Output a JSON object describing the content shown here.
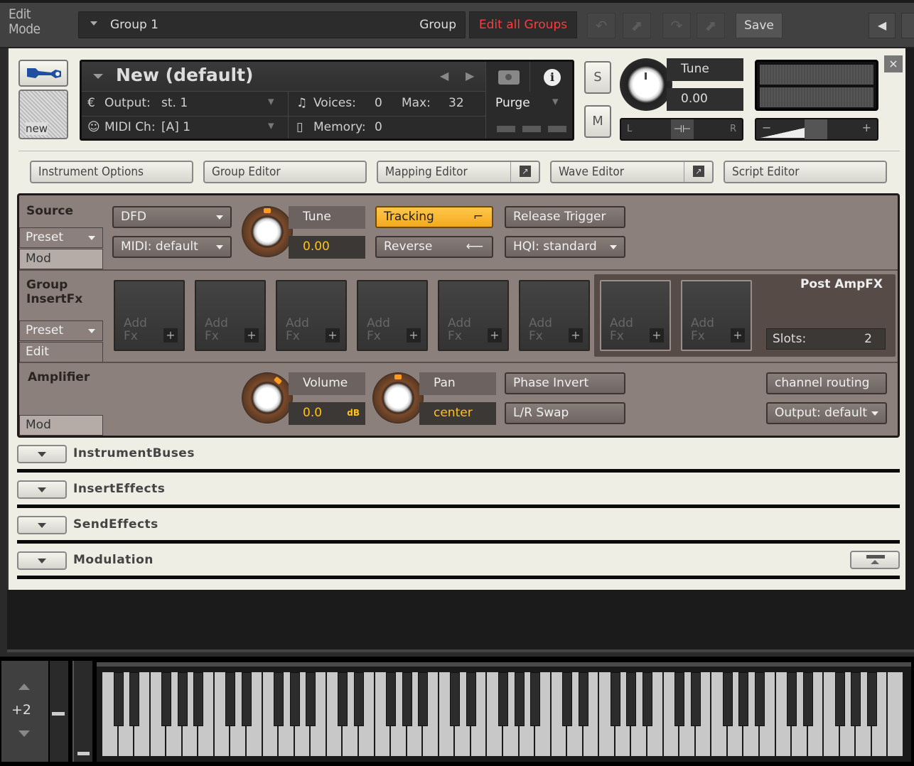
{
  "topbar": {
    "edit_mode_label": "Edit\nMode",
    "group_selector": "Group 1",
    "group_label": "Group",
    "edit_all_groups": "Edit all Groups",
    "save_label": "Save",
    "undo_icon": "undo-icon",
    "redo_icon": "redo-icon",
    "edit_all_color": "#ff3a3a"
  },
  "instrument": {
    "name": "New (default)",
    "new_label": "new",
    "output_label": "Output:",
    "output_value": "st. 1",
    "midi_label": "MIDI Ch:",
    "midi_value": "[A]  1",
    "voices_label": "Voices:",
    "voices_value": "0",
    "max_label": "Max:",
    "max_value": "32",
    "memory_label": "Memory:",
    "memory_value": "0",
    "purge_label": "Purge",
    "solo_label": "S",
    "mute_label": "M",
    "tune_label": "Tune",
    "tune_value": "0.00",
    "pan_left": "L",
    "pan_right": "R",
    "vol_minus": "−",
    "vol_plus": "+",
    "close_label": "×"
  },
  "editors": [
    {
      "label": "Instrument Options"
    },
    {
      "label": "Group Editor"
    },
    {
      "label": "Mapping Editor"
    },
    {
      "label": "Wave Editor"
    },
    {
      "label": "Script Editor"
    }
  ],
  "source": {
    "title": "Source",
    "preset_tab": "Preset",
    "mod_tab": "Mod",
    "mode_select": "DFD",
    "midi_select": "MIDI: default",
    "tune_label": "Tune",
    "tune_value": "0.00",
    "tracking_label": "Tracking",
    "tracking_on": true,
    "reverse_label": "Reverse",
    "release_trigger_label": "Release Trigger",
    "hqi_select": "HQI: standard",
    "accent_color": "#f4a820"
  },
  "group_insert_fx": {
    "title_line1": "Group",
    "title_line2": "InsertFx",
    "preset_tab": "Preset",
    "edit_tab": "Edit",
    "slots": [
      {
        "line1": "Add",
        "line2": "Fx"
      },
      {
        "line1": "Add",
        "line2": "Fx"
      },
      {
        "line1": "Add",
        "line2": "Fx"
      },
      {
        "line1": "Add",
        "line2": "Fx"
      },
      {
        "line1": "Add",
        "line2": "Fx"
      },
      {
        "line1": "Add",
        "line2": "Fx"
      }
    ],
    "post_amp": {
      "title": "Post AmpFX",
      "slots_label": "Slots:",
      "slots_value": "2",
      "slots": [
        {
          "line1": "Add",
          "line2": "Fx"
        },
        {
          "line1": "Add",
          "line2": "Fx"
        }
      ]
    }
  },
  "amplifier": {
    "title": "Amplifier",
    "mod_tab": "Mod",
    "volume_label": "Volume",
    "volume_value": "0.0",
    "volume_unit": "dB",
    "pan_label": "Pan",
    "pan_value": "center",
    "phase_invert_label": "Phase Invert",
    "lr_swap_label": "L/R Swap",
    "channel_routing_label": "channel routing",
    "output_select": "Output: default"
  },
  "sections": [
    {
      "title": "InstrumentBuses"
    },
    {
      "title": "InsertEffects"
    },
    {
      "title": "SendEffects"
    },
    {
      "title": "Modulation"
    }
  ],
  "keyboard": {
    "octave_offset": "+2",
    "white_key_count": 50
  }
}
